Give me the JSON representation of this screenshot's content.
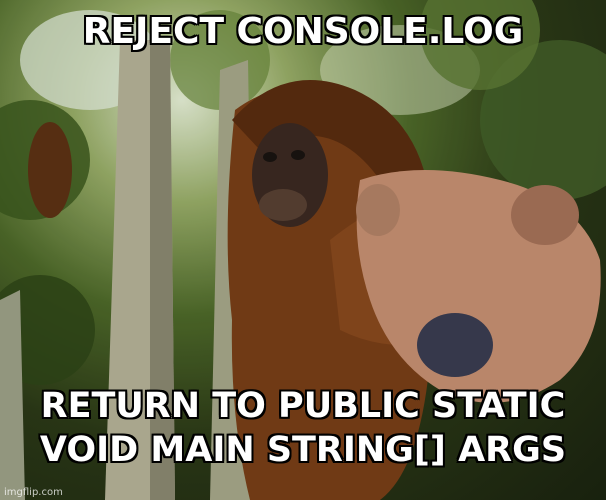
{
  "meme": {
    "top_text": "REJECT CONSOLE.LOG",
    "bottom_line_1": "RETURN TO PUBLIC STATIC",
    "bottom_line_2": "VOID MAIN STRING[] ARGS",
    "watermark": "imgflip.com"
  },
  "image": {
    "subject": "orangutan reaching toward camera in jungle trees",
    "colors": {
      "foliage": "#4f6b2a",
      "fur": "#8a4a1e",
      "bark": "#b8b59a",
      "text": "#ffffff",
      "outline": "#000000"
    }
  }
}
